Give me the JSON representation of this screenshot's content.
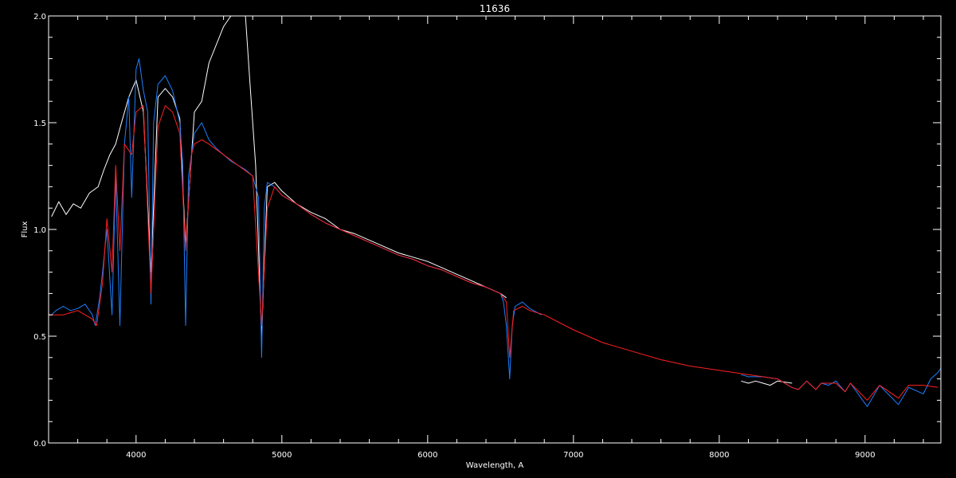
{
  "chart_data": {
    "type": "line",
    "title": "11636",
    "xlabel": "Wavelength, A",
    "ylabel": "Flux",
    "xlim": [
      3400,
      9520
    ],
    "ylim": [
      0.0,
      2.0
    ],
    "x_ticks": [
      4000,
      5000,
      6000,
      7000,
      8000,
      9000
    ],
    "x_tick_labels": [
      "4000",
      "5000",
      "6000",
      "7000",
      "8000",
      "9000"
    ],
    "y_ticks": [
      0.0,
      0.5,
      1.0,
      1.5,
      2.0
    ],
    "y_tick_labels": [
      "0.0",
      "0.5",
      "1.0",
      "1.5",
      "2.0"
    ],
    "legend": "none",
    "grid": false,
    "background": "#000000",
    "series": [
      {
        "color": "#ffffff",
        "style": "line",
        "segments": [
          {
            "x": [
              3420,
              3470,
              3520,
              3570,
              3620,
              3680,
              3740,
              3780,
              3820,
              3860,
              3900,
              3950,
              4000,
              4050,
              4102,
              4150,
              4200,
              4250,
              4300,
              4340,
              4400,
              4450,
              4500,
              4600,
              4650,
              4700,
              4750,
              4780,
              4820,
              4861,
              4900,
              4950,
              5000,
              5100,
              5200,
              5300,
              5400,
              5500,
              5600,
              5700,
              5800,
              5900,
              6000,
              6100,
              6200,
              6300,
              6400,
              6500,
              6540
            ],
            "y": [
              1.06,
              1.13,
              1.07,
              1.12,
              1.1,
              1.17,
              1.2,
              1.28,
              1.35,
              1.4,
              1.5,
              1.62,
              1.7,
              1.55,
              0.8,
              1.62,
              1.66,
              1.62,
              1.52,
              0.92,
              1.55,
              1.6,
              1.78,
              1.95,
              2.0,
              2.0,
              2.0,
              1.7,
              1.3,
              0.5,
              1.2,
              1.22,
              1.18,
              1.12,
              1.08,
              1.05,
              1.0,
              0.98,
              0.95,
              0.92,
              0.89,
              0.87,
              0.85,
              0.82,
              0.79,
              0.76,
              0.73,
              0.7,
              0.68
            ]
          },
          {
            "x": [
              8150,
              8200,
              8250,
              8300,
              8350,
              8400,
              8500
            ],
            "y": [
              0.29,
              0.28,
              0.29,
              0.28,
              0.27,
              0.29,
              0.28
            ]
          }
        ]
      },
      {
        "color": "#1e7fff",
        "style": "line",
        "segments": [
          {
            "x": [
              3420,
              3450,
              3500,
              3550,
              3600,
              3650,
              3700,
              3720,
              3750,
              3770,
              3800,
              3835,
              3860,
              3889,
              3920,
              3950,
              3970,
              4000,
              4020,
              4050,
              4080,
              4102,
              4120,
              4150,
              4200,
              4250,
              4300,
              4320,
              4340,
              4360,
              4400,
              4450,
              4500,
              4550,
              4600,
              4650,
              4700,
              4750,
              4800,
              4840,
              4861,
              4880,
              4900,
              4950,
              5000,
              5100,
              5200,
              5300,
              5400,
              5500,
              5600,
              5700,
              5800,
              5900,
              6000,
              6100,
              6200,
              6300,
              6400,
              6500,
              6520,
              6540,
              6563,
              6580,
              6600,
              6650,
              6700,
              6780
            ],
            "y": [
              0.6,
              0.62,
              0.64,
              0.62,
              0.63,
              0.65,
              0.6,
              0.55,
              0.68,
              0.8,
              1.0,
              0.6,
              1.25,
              0.55,
              1.4,
              1.62,
              1.15,
              1.75,
              1.8,
              1.65,
              1.55,
              0.65,
              1.5,
              1.68,
              1.72,
              1.65,
              1.5,
              1.3,
              0.55,
              1.25,
              1.45,
              1.5,
              1.42,
              1.38,
              1.35,
              1.32,
              1.3,
              1.28,
              1.25,
              1.15,
              0.4,
              1.1,
              1.22,
              1.2,
              1.16,
              1.12,
              1.07,
              1.03,
              1.0,
              0.97,
              0.94,
              0.91,
              0.88,
              0.86,
              0.83,
              0.81,
              0.78,
              0.75,
              0.73,
              0.7,
              0.66,
              0.55,
              0.3,
              0.55,
              0.64,
              0.66,
              0.63,
              0.6
            ]
          },
          {
            "x": [
              8150,
              8200,
              8300,
              8400,
              8498,
              8542,
              8600,
              8662,
              8700,
              8750,
              8800,
              8863,
              8900,
              9015,
              9100,
              9229,
              9300,
              9400,
              9450,
              9500,
              9520
            ],
            "y": [
              0.32,
              0.31,
              0.31,
              0.3,
              0.26,
              0.25,
              0.29,
              0.25,
              0.28,
              0.27,
              0.29,
              0.24,
              0.28,
              0.17,
              0.27,
              0.18,
              0.26,
              0.23,
              0.3,
              0.33,
              0.35
            ]
          }
        ]
      },
      {
        "color": "#ff2020",
        "style": "line",
        "segments": [
          {
            "x": [
              3400,
              3450,
              3500,
              3550,
              3600,
              3650,
              3700,
              3730,
              3770,
              3800,
              3835,
              3860,
              3889,
              3920,
              3970,
              4000,
              4050,
              4102,
              4150,
              4200,
              4250,
              4300,
              4340,
              4380,
              4400,
              4450,
              4500,
              4600,
              4700,
              4800,
              4861,
              4900,
              4950,
              5000,
              5100,
              5200,
              5300,
              5400,
              5500,
              5600,
              5700,
              5800,
              5900,
              6000,
              6100,
              6200,
              6300,
              6400,
              6500,
              6540,
              6563,
              6590,
              6650,
              6700,
              6800,
              7000,
              7200,
              7400,
              7600,
              7800,
              8000,
              8200,
              8400,
              8498,
              8542,
              8600,
              8662,
              8700,
              8800,
              8863,
              8900,
              9015,
              9100,
              9229,
              9300,
              9400,
              9500
            ],
            "y": [
              0.6,
              0.6,
              0.6,
              0.61,
              0.62,
              0.6,
              0.58,
              0.55,
              0.75,
              1.05,
              0.8,
              1.3,
              0.9,
              1.4,
              1.35,
              1.55,
              1.58,
              0.7,
              1.48,
              1.58,
              1.55,
              1.45,
              0.9,
              1.35,
              1.4,
              1.42,
              1.4,
              1.35,
              1.3,
              1.25,
              0.55,
              1.1,
              1.2,
              1.16,
              1.12,
              1.07,
              1.03,
              1.0,
              0.97,
              0.94,
              0.91,
              0.88,
              0.86,
              0.83,
              0.81,
              0.78,
              0.75,
              0.73,
              0.7,
              0.66,
              0.4,
              0.62,
              0.64,
              0.62,
              0.6,
              0.53,
              0.47,
              0.43,
              0.39,
              0.36,
              0.34,
              0.32,
              0.3,
              0.26,
              0.25,
              0.29,
              0.25,
              0.28,
              0.28,
              0.24,
              0.28,
              0.2,
              0.27,
              0.21,
              0.27,
              0.27,
              0.26
            ]
          }
        ]
      }
    ]
  }
}
